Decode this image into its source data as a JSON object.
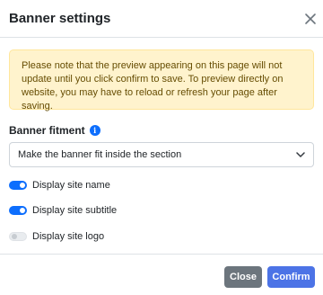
{
  "modal": {
    "title": "Banner settings",
    "close_icon": "close-icon"
  },
  "alert": {
    "text": "Please note that the preview appearing on this page will not update until you click confirm to save. To preview directly on website, you may have to reload or refresh your page after saving."
  },
  "fitment": {
    "label": "Banner fitment",
    "info_icon": "info-icon",
    "info_glyph": "i",
    "selected": "Make the banner fit inside the section",
    "chevron_icon": "chevron-down-icon"
  },
  "toggles": [
    {
      "label": "Display site name",
      "on": true
    },
    {
      "label": "Display site subtitle",
      "on": true
    },
    {
      "label": "Display site logo",
      "on": false
    }
  ],
  "footer": {
    "close_label": "Close",
    "confirm_label": "Confirm"
  },
  "colors": {
    "primary": "#0d6efd",
    "confirm_button": "#4c73e6",
    "close_button": "#6c757d",
    "alert_bg": "#fff3cd",
    "alert_text": "#664d03"
  }
}
